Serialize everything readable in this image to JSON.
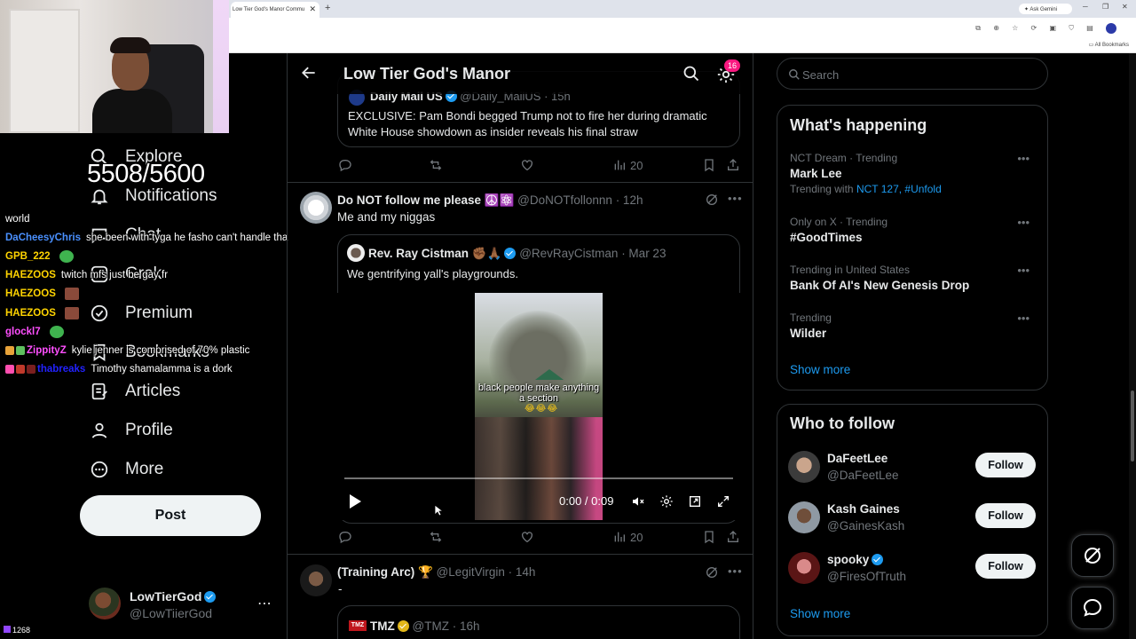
{
  "browser": {
    "tab_title": "Low Tier God's Manor Commu",
    "ask_gemini": "Ask Gemini",
    "all_bookmarks": "All Bookmarks"
  },
  "stream": {
    "counter": "5508/5600",
    "viewer_count": "1268",
    "chat": [
      {
        "user": "",
        "message": "world",
        "color": "#ffffff"
      },
      {
        "user": "DaCheesyChris",
        "message": "she been with tyga he fasho can't handle tha",
        "color": "#4a90ff"
      },
      {
        "user": "GPB_222",
        "message": "",
        "color": "#ffd400"
      },
      {
        "user": "HAEZOOS",
        "message": "twitch mfs just be gay fr",
        "color": "#ffd400"
      },
      {
        "user": "HAEZOOS",
        "message": "",
        "color": "#ffd400"
      },
      {
        "user": "HAEZOOS",
        "message": "",
        "color": "#ffd400"
      },
      {
        "user": "glockl7",
        "message": "",
        "color": "#ff4fff"
      },
      {
        "user": "ZippityZ",
        "message": "kylie jenner is comprised of 70% plastic",
        "color": "#ff4fff"
      },
      {
        "user": "thabreaks",
        "message": "Timothy shamalamma is a dork",
        "color": "#2222ff"
      }
    ]
  },
  "nav": {
    "items": [
      {
        "label": "Explore",
        "icon": "search-icon"
      },
      {
        "label": "Notifications",
        "icon": "bell-icon"
      },
      {
        "label": "Chat",
        "icon": "chat-icon"
      },
      {
        "label": "Grok",
        "icon": "grok-icon"
      },
      {
        "label": "Premium",
        "icon": "premium-icon"
      },
      {
        "label": "Bookmarks",
        "icon": "bookmark-icon"
      },
      {
        "label": "Articles",
        "icon": "articles-icon"
      },
      {
        "label": "Profile",
        "icon": "profile-icon"
      },
      {
        "label": "More",
        "icon": "more-icon"
      }
    ],
    "post_label": "Post",
    "me": {
      "name": "LowTierGod",
      "handle": "@LowTiierGod"
    }
  },
  "header": {
    "title": "Low Tier God's Manor",
    "settings_badge": "16"
  },
  "feed": {
    "tweet0": {
      "quote_source": "Daily Mail US",
      "quote_handle": "@Daily_MailUS · 15h",
      "quote_text": "EXCLUSIVE: Pam Bondi begged Trump not to fire her during dramatic White House showdown as insider reveals his final straw",
      "views": "20"
    },
    "tweet1": {
      "name": "Do NOT follow me please ☮️⚛️",
      "handle": "@DoNOTfollonnn",
      "time": "· 12h",
      "text": "Me and my niggas",
      "quote_name": "Rev. Ray Cistman ✊🏾🙏🏾",
      "quote_handle": "@RevRayCistman",
      "quote_time": "· Mar 23",
      "quote_text": "We gentrifying yall's playgrounds.",
      "video_caption": "black people make anything a section",
      "video_emoji": "😂😂😂",
      "video_time": "0:00 / 0:09",
      "views": "20"
    },
    "tweet2": {
      "name": "(Training Arc) 🏆",
      "handle": "@LegitVirgin",
      "time": "· 14h",
      "text": "-",
      "quote_name": "TMZ",
      "quote_handle": "@TMZ",
      "quote_time": "· 16h"
    }
  },
  "sidebar": {
    "search_placeholder": "Search",
    "happening_title": "What's happening",
    "trends": [
      {
        "category": "NCT Dream · Trending",
        "name": "Mark Lee",
        "with_prefix": "Trending with ",
        "with_links": "NCT 127, #Unfold"
      },
      {
        "category": "Only on X · Trending",
        "name": "#GoodTimes"
      },
      {
        "category": "Trending in United States",
        "name": "Bank Of AI's New Genesis Drop"
      },
      {
        "category": "Trending",
        "name": "Wilder"
      }
    ],
    "show_more": "Show more",
    "who_title": "Who to follow",
    "follow": [
      {
        "name": "DaFeetLee",
        "handle": "@DaFeetLee",
        "button": "Follow"
      },
      {
        "name": "Kash Gaines",
        "handle": "@GainesKash",
        "button": "Follow"
      },
      {
        "name": "spooky",
        "handle": "@FiresOfTruth",
        "button": "Follow"
      }
    ],
    "who_show_more": "Show more"
  },
  "colors": {
    "accent": "#1d9bf0",
    "background": "#000000",
    "border": "#2f3336",
    "muted": "#71767b",
    "badge": "#f91880"
  }
}
